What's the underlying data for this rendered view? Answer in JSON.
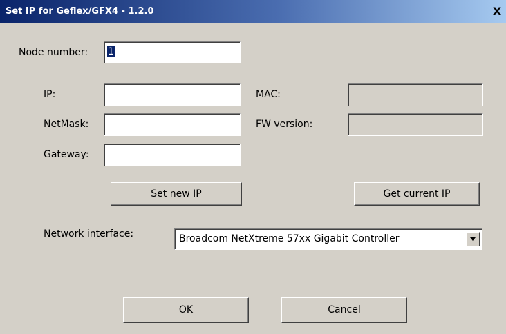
{
  "window": {
    "title": "Set IP for Geflex/GFX4 - 1.2.0",
    "close_glyph": "X"
  },
  "form": {
    "node_label": "Node number:",
    "node_value": "1",
    "ip_label": "IP:",
    "ip_value": "",
    "netmask_label": "NetMask:",
    "netmask_value": "",
    "gateway_label": "Gateway:",
    "gateway_value": "",
    "mac_label": "MAC:",
    "mac_value": "",
    "fw_label": "FW version:",
    "fw_value": ""
  },
  "buttons": {
    "set_ip": "Set new IP",
    "get_ip": "Get current IP",
    "ok": "OK",
    "cancel": "Cancel"
  },
  "network": {
    "label": "Network interface:",
    "selected": "Broadcom NetXtreme 57xx Gigabit Controller",
    "dropdown_icon": "chevron-down-icon"
  },
  "colors": {
    "dialog_bg": "#d4d0c8",
    "title_start": "#0a246a",
    "title_end": "#a6caf0",
    "selection": "#0a246a"
  }
}
